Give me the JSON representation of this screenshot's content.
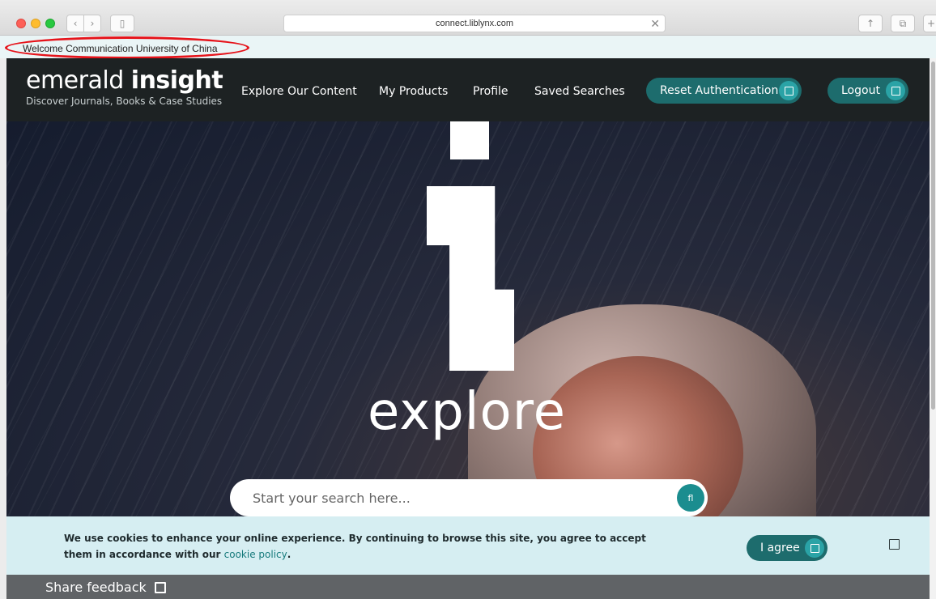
{
  "browser": {
    "url": "connect.liblynx.com",
    "icons": {
      "back": "chevron-left-icon",
      "forward": "chevron-right-icon",
      "sidebar": "sidebar-icon",
      "clear": "close-icon",
      "share": "share-icon",
      "tabs": "tabs-icon",
      "new_tab": "plus-icon"
    }
  },
  "welcome": {
    "text": "Welcome Communication University of China"
  },
  "header": {
    "brand": {
      "light": "emerald",
      "bold": "insight",
      "tagline": "Discover Journals, Books & Case Studies"
    },
    "nav": [
      "Explore Our Content",
      "My Products",
      "Profile",
      "Saved Searches"
    ],
    "reset_label": "Reset Authentication",
    "logout_label": "Logout"
  },
  "hero": {
    "word": "explore",
    "search_placeholder": "Start your search here...",
    "search_button_glyph": "fl"
  },
  "cookie": {
    "text": "We use cookies to enhance your online experience. By continuing to browse this site, you agree to accept them in accordance with our",
    "link_text": "cookie policy",
    "trailing": ".",
    "agree_label": "I agree"
  },
  "feedback": {
    "label": "Share feedback"
  },
  "colors": {
    "brand_teal": "#1d6c6d",
    "accent_teal": "#2aa3a6",
    "header_bg": "#1d2223",
    "cookie_bg": "#d6eef2",
    "annotation_red": "#e6131a"
  }
}
